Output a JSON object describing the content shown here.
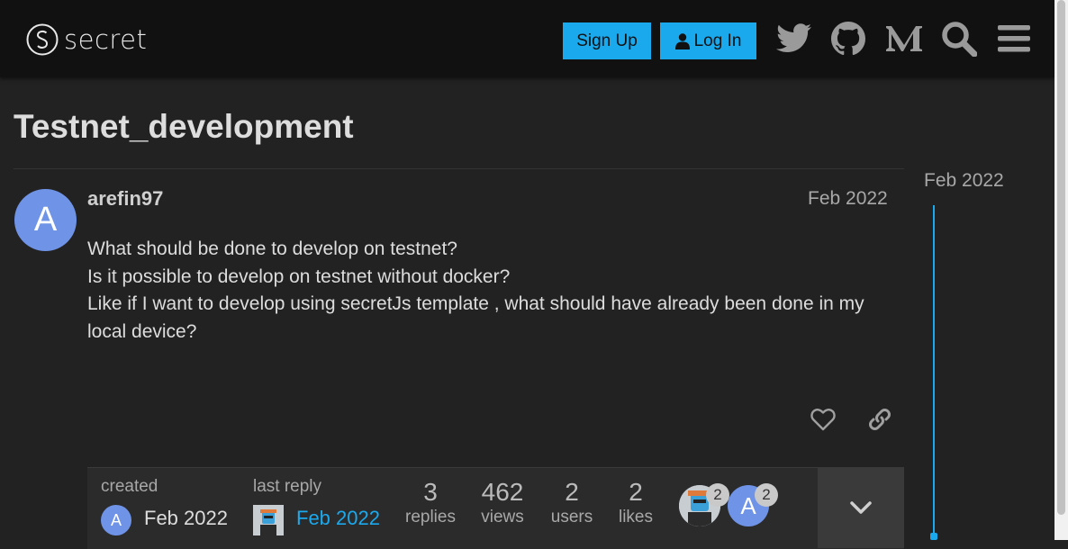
{
  "header": {
    "brand_name": "secret",
    "signup_label": "Sign Up",
    "login_label": "Log In",
    "icons": [
      "twitter-icon",
      "github-icon",
      "medium-icon",
      "search-icon",
      "menu-icon"
    ]
  },
  "topic": {
    "title": "Testnet_development"
  },
  "post": {
    "avatar_letter": "A",
    "username": "arefin97",
    "date": "Feb 2022",
    "lines": [
      "What should be done to develop on testnet?",
      "Is it possible to develop on testnet without docker?",
      "Like if I want to develop using secretJs template , what should have already been done in my local device?"
    ]
  },
  "summary": {
    "created_label": "created",
    "created_avatar_letter": "A",
    "created_date": "Feb 2022",
    "last_reply_label": "last reply",
    "last_reply_date": "Feb 2022",
    "replies": "3",
    "replies_label": "replies",
    "views": "462",
    "views_label": "views",
    "users": "2",
    "users_label": "users",
    "likes": "2",
    "likes_label": "likes",
    "participant_1_count": "2",
    "participant_2_letter": "A",
    "participant_2_count": "2"
  },
  "timeline": {
    "date": "Feb 2022"
  },
  "colors": {
    "accent": "#1ba9ed",
    "background": "#222222",
    "header": "#111111",
    "avatar_blue": "#6f93e6"
  }
}
